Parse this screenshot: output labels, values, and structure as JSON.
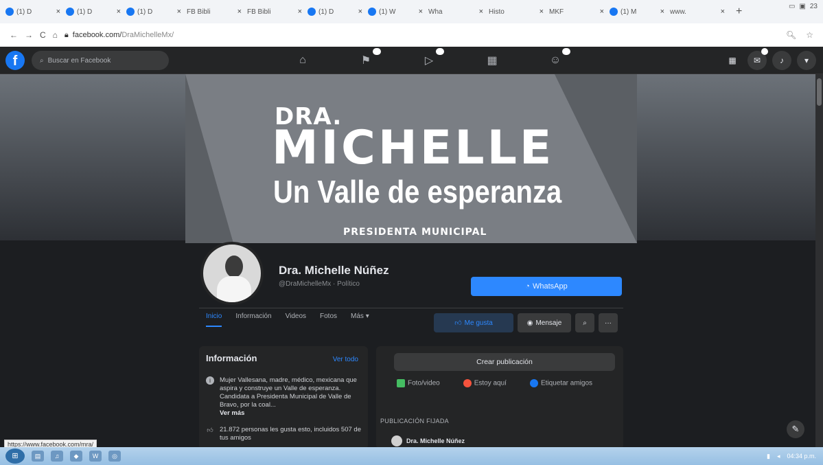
{
  "browser": {
    "tabs": [
      {
        "label": "(1) D"
      },
      {
        "label": "(1) D"
      },
      {
        "label": "(1) D"
      },
      {
        "label": "FB Bibli"
      },
      {
        "label": "FB Bibli"
      },
      {
        "label": "(1) D"
      },
      {
        "label": "(1) W"
      },
      {
        "label": "Wha"
      },
      {
        "label": "Histo"
      },
      {
        "label": "MKF"
      },
      {
        "label": "(1) M"
      },
      {
        "label": "www."
      }
    ],
    "new_tab_label": "+",
    "window_controls": "23",
    "url_domain": "facebook.com/",
    "url_path": "DraMichelleMx/"
  },
  "facebook": {
    "logo": "f",
    "search_placeholder": "Buscar en Facebook"
  },
  "cover": {
    "line1": "DRA.",
    "line2": "MICHELLE",
    "slogan": "Un Valle de esperanza",
    "role": "PRESIDENTA MUNICIPAL"
  },
  "profile": {
    "name": "Dra. Michelle Núñez",
    "handle": "@DraMichelleMx · Político",
    "whatsapp_label": "WhatsApp"
  },
  "profile_tabs": [
    {
      "label": "Inicio"
    },
    {
      "label": "Información"
    },
    {
      "label": "Videos"
    },
    {
      "label": "Fotos"
    },
    {
      "label": "Más ▾"
    }
  ],
  "actions": {
    "like": "Me gusta",
    "message": "Mensaje",
    "more": "···"
  },
  "info": {
    "heading": "Información",
    "see_all": "Ver todo",
    "bio": "Mujer Vallesana, madre, médico, mexicana que aspira y construye un Valle de esperanza. Candidata a Presidenta Municipal de Valle de Bravo, por la coal...",
    "see_more": "Ver más",
    "likes": "21.872 personas les gusta esto, incluidos 507 de tus amigos"
  },
  "post": {
    "create": "Crear publicación",
    "photo": "Foto/video",
    "here": "Estoy aquí",
    "tag": "Etiquetar amigos",
    "pinned": "PUBLICACIÓN FIJADA",
    "author": "Dra. Michelle Núñez"
  },
  "status_url": "https://www.facebook.com/mra/",
  "taskbar": {
    "clock": "04:34 p.m."
  },
  "colors": {
    "fb_blue": "#1877f2",
    "accent": "#2d88ff",
    "page_bg": "#18191a",
    "surface": "#242526"
  }
}
